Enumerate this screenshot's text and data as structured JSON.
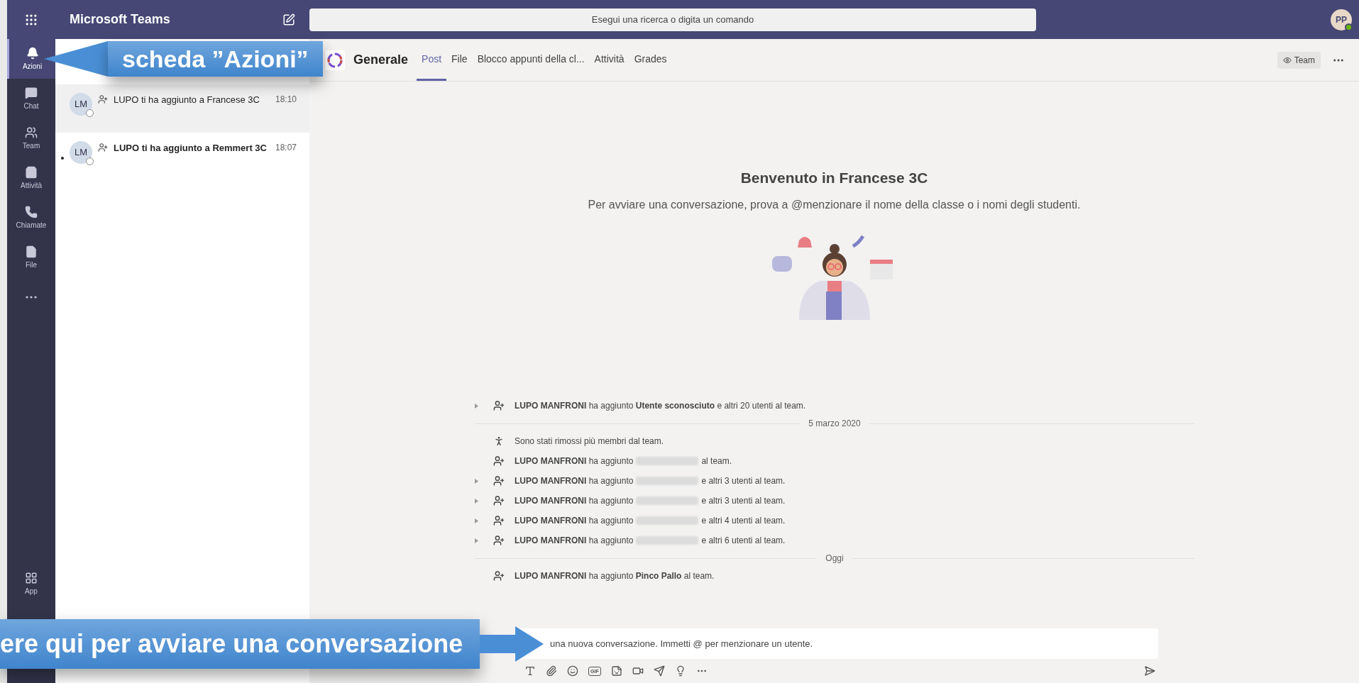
{
  "app": {
    "title": "Microsoft Teams",
    "avatar": "PP"
  },
  "search": {
    "placeholder": "Esegui una ricerca o digita un comando"
  },
  "rail": [
    {
      "label": "Azioni",
      "selected": true
    },
    {
      "label": "Chat",
      "selected": false
    },
    {
      "label": "Team",
      "selected": false
    },
    {
      "label": "Attività",
      "selected": false
    },
    {
      "label": "Chiamate",
      "selected": false
    },
    {
      "label": "File",
      "selected": false
    }
  ],
  "rail_bottom": {
    "label": "App"
  },
  "feed": [
    {
      "initials": "LM",
      "text": "LUPO ti ha aggiunto a Francese 3C",
      "time": "18:10",
      "unread": false,
      "selected": true
    },
    {
      "initials": "LM",
      "text": "LUPO ti ha aggiunto a Remmert 3C",
      "time": "18:07",
      "unread": true,
      "selected": false
    }
  ],
  "channel": {
    "name": "Generale",
    "tabs": [
      {
        "label": "Post",
        "selected": true
      },
      {
        "label": "File",
        "selected": false
      },
      {
        "label": "Blocco appunti della cl...",
        "selected": false
      },
      {
        "label": "Attività",
        "selected": false
      },
      {
        "label": "Grades",
        "selected": false
      }
    ],
    "team_button": "Team"
  },
  "welcome": {
    "title": "Benvenuto in Francese 3C",
    "subtitle": "Per avviare una conversazione, prova a @menzionare il nome della classe o i nomi degli studenti."
  },
  "activity": [
    {
      "kind": "added",
      "expandable": true,
      "text": "**LUPO MANFRONI** ha aggiunto **Utente sconosciuto** e altri 20 utenti al team."
    },
    {
      "kind": "divider",
      "text": "5 marzo 2020"
    },
    {
      "kind": "removed",
      "expandable": false,
      "text": "Sono stati rimossi più membri dal team."
    },
    {
      "kind": "added",
      "expandable": false,
      "text": "**LUPO MANFRONI** ha aggiunto",
      "redacted": true,
      "after": "al team."
    },
    {
      "kind": "added",
      "expandable": true,
      "text": "**LUPO MANFRONI** ha aggiunto",
      "redacted": true,
      "after": "e altri 3 utenti al team."
    },
    {
      "kind": "added",
      "expandable": true,
      "text": "**LUPO MANFRONI** ha aggiunto",
      "redacted": true,
      "after": "e altri 3 utenti al team."
    },
    {
      "kind": "added",
      "expandable": true,
      "text": "**LUPO MANFRONI** ha aggiunto",
      "redacted": true,
      "after": "e altri 4 utenti al team."
    },
    {
      "kind": "added",
      "expandable": true,
      "text": "**LUPO MANFRONI** ha aggiunto",
      "redacted": true,
      "after": "e altri 6 utenti al team."
    },
    {
      "kind": "divider",
      "text": "Oggi"
    },
    {
      "kind": "added",
      "expandable": false,
      "text": "**LUPO MANFRONI** ha aggiunto **Pinco Pallo** al team."
    }
  ],
  "composer": {
    "placeholder": "una nuova conversazione. Immetti @ per menzionare un utente.",
    "gif_label": "GIF"
  },
  "callouts": [
    {
      "text": "scheda ”Azioni”"
    },
    {
      "text": "ere qui per avviare una conversazione"
    }
  ]
}
